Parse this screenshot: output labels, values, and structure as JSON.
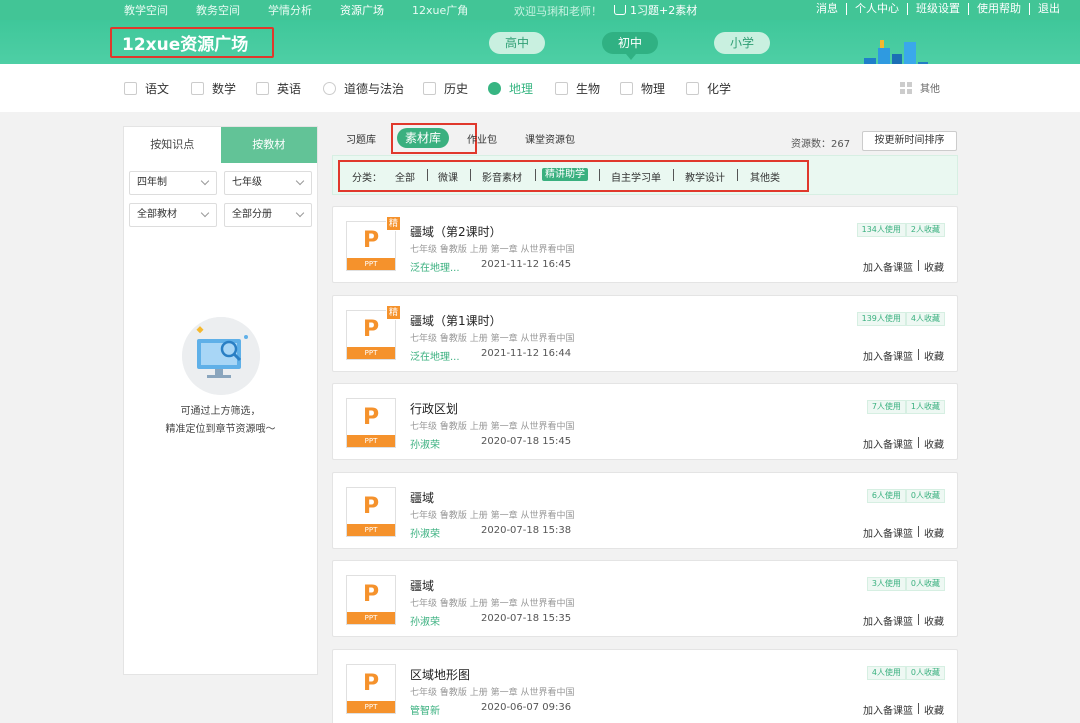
{
  "topnav": {
    "left": [
      "教学空间",
      "教务空间",
      "学情分析",
      "资源广场",
      "12xue广角"
    ],
    "active_index": 3,
    "welcome": "欢迎马琍和老师！",
    "basket": "1习题+2素材",
    "right": [
      "消息",
      "个人中心",
      "班级设置",
      "使用帮助",
      "退出"
    ]
  },
  "banner": {
    "logo": "12xue资源广场",
    "stages": [
      "高中",
      "初中",
      "小学"
    ],
    "active_stage": "初中"
  },
  "subjects": [
    "语文",
    "数学",
    "英语",
    "道德与法治",
    "历史",
    "地理",
    "生物",
    "物理",
    "化学"
  ],
  "active_subject": "地理",
  "other_label": "其他",
  "left": {
    "tabs": [
      "按知识点",
      "按教材"
    ],
    "active_tab": "按教材",
    "selects": [
      "四年制",
      "七年级",
      "全部教材",
      "全部分册"
    ],
    "hint_line1": "可通过上方筛选，",
    "hint_line2": "精准定位到章节资源哦～"
  },
  "resource_tabs": [
    "习题库",
    "素材库",
    "作业包",
    "课堂资源包"
  ],
  "active_resource_tab": "素材库",
  "resource_count": "资源数：267",
  "sort_button": "按更新时间排序",
  "filter": {
    "label": "分类：",
    "items": [
      "全部",
      "微课",
      "影音素材",
      "精讲助学",
      "自主学习单",
      "教学设计",
      "其他类"
    ],
    "active": "精讲助学"
  },
  "icon_badge": "精",
  "icon_type": "PPT",
  "icon_letter": "P",
  "cards": [
    {
      "title": "疆域（第2课时）",
      "meta": "七年级 鲁教版 上册 第一章 从世界看中国",
      "author": "泛在地理...",
      "date": "2021-11-12 16:45",
      "uses": "134人使用",
      "favs": "2人收藏",
      "badge": true
    },
    {
      "title": "疆域（第1课时）",
      "meta": "七年级 鲁教版 上册 第一章 从世界看中国",
      "author": "泛在地理...",
      "date": "2021-11-12 16:44",
      "uses": "139人使用",
      "favs": "4人收藏",
      "badge": true
    },
    {
      "title": "行政区划",
      "meta": "七年级 鲁教版 上册 第一章 从世界看中国",
      "author": "孙淑荣",
      "date": "2020-07-18 15:45",
      "uses": "7人使用",
      "favs": "1人收藏",
      "badge": false
    },
    {
      "title": "疆域",
      "meta": "七年级 鲁教版 上册 第一章 从世界看中国",
      "author": "孙淑荣",
      "date": "2020-07-18 15:38",
      "uses": "6人使用",
      "favs": "0人收藏",
      "badge": false
    },
    {
      "title": "疆域",
      "meta": "七年级 鲁教版 上册 第一章 从世界看中国",
      "author": "孙淑荣",
      "date": "2020-07-18 15:35",
      "uses": "3人使用",
      "favs": "0人收藏",
      "badge": false
    },
    {
      "title": "区域地形图",
      "meta": "七年级 鲁教版 上册 第一章 从世界看中国",
      "author": "管智新",
      "date": "2020-06-07 09:36",
      "uses": "4人使用",
      "favs": "0人收藏",
      "badge": false
    }
  ],
  "card_actions": [
    "加入备课篮",
    "收藏"
  ],
  "colors": {
    "brand": "#42c596",
    "accent": "#3ab07f",
    "highlight": "#e0382c",
    "ppt": "#f5922c"
  }
}
